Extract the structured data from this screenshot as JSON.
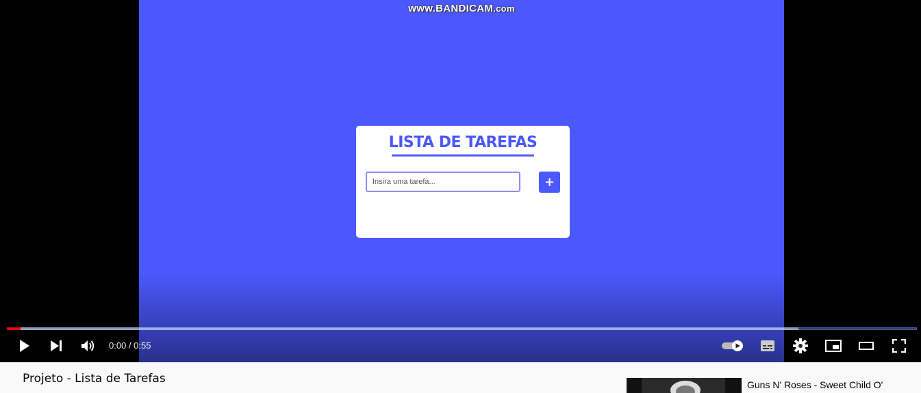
{
  "video": {
    "watermark_main": "www.BANDICAM",
    "watermark_suffix": ".com",
    "app": {
      "title": "LISTA DE TAREFAS",
      "input_placeholder": "Insira uma tarefa...",
      "add_button_label": "+",
      "accent_color": "#4a58fd"
    }
  },
  "player": {
    "time_display": "0:00 / 0:55",
    "progress_played": 0.015,
    "progress_buffered": 0.87,
    "progress_color": "#ff0000",
    "autoplay_on": true,
    "icons": {
      "play": "play-icon",
      "next": "next-icon",
      "volume": "volume-icon",
      "autoplay": "autoplay-toggle-icon",
      "subtitles": "subtitles-icon",
      "settings": "gear-icon",
      "miniplayer": "miniplayer-icon",
      "theater": "theater-mode-icon",
      "fullscreen": "fullscreen-icon"
    }
  },
  "page": {
    "video_title": "Projeto - Lista de Tarefas"
  },
  "recommendation": {
    "title": "Guns N' Roses - Sweet Child O'"
  }
}
